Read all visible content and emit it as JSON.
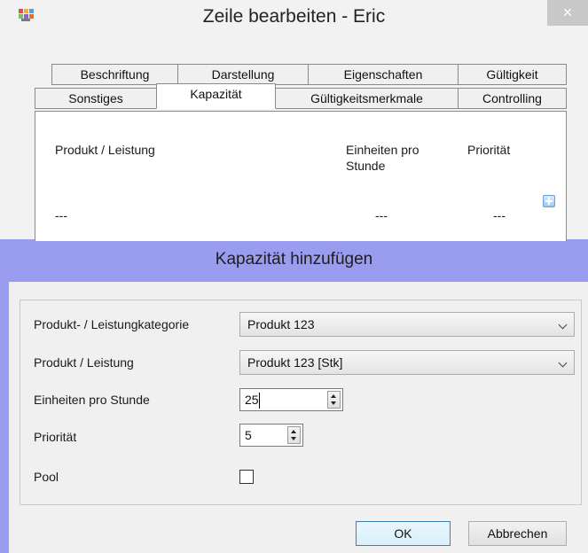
{
  "background_window": {
    "title": "Zeile  bearbeiten - Eric",
    "close_glyph": "×",
    "tabs_row1": [
      "Beschriftung",
      "Darstellung",
      "Eigenschaften",
      "Gültigkeit"
    ],
    "tabs_row2": [
      "Sonstiges",
      "Kapazität",
      "Gültigkeitsmerkmale",
      "Controlling"
    ],
    "active_tab": "Kapazität",
    "capacity_table": {
      "headers": [
        "Produkt / Leistung",
        "Einheiten pro Stunde",
        "Priorität"
      ],
      "row": [
        "---",
        "---",
        "---"
      ]
    }
  },
  "dialog": {
    "title": "Kapazität hinzufügen",
    "fields": {
      "category": {
        "label": "Produkt- / Leistungkategorie",
        "value": "Produkt 123"
      },
      "product": {
        "label": "Produkt / Leistung",
        "value": "Produkt 123 [Stk]"
      },
      "units": {
        "label": "Einheiten pro Stunde",
        "value": "25"
      },
      "priority": {
        "label": "Priorität",
        "value": "5"
      },
      "pool": {
        "label": "Pool",
        "checked": false
      }
    },
    "buttons": {
      "ok": "OK",
      "cancel": "Abbrechen"
    }
  },
  "colors": {
    "dialog_frame": "#9a9cf0",
    "window_background": "#f0f0f0"
  },
  "icons": [
    "app-icon",
    "close-icon",
    "add-icon",
    "chevron-down-icon",
    "spin-up-icon",
    "spin-down-icon"
  ]
}
